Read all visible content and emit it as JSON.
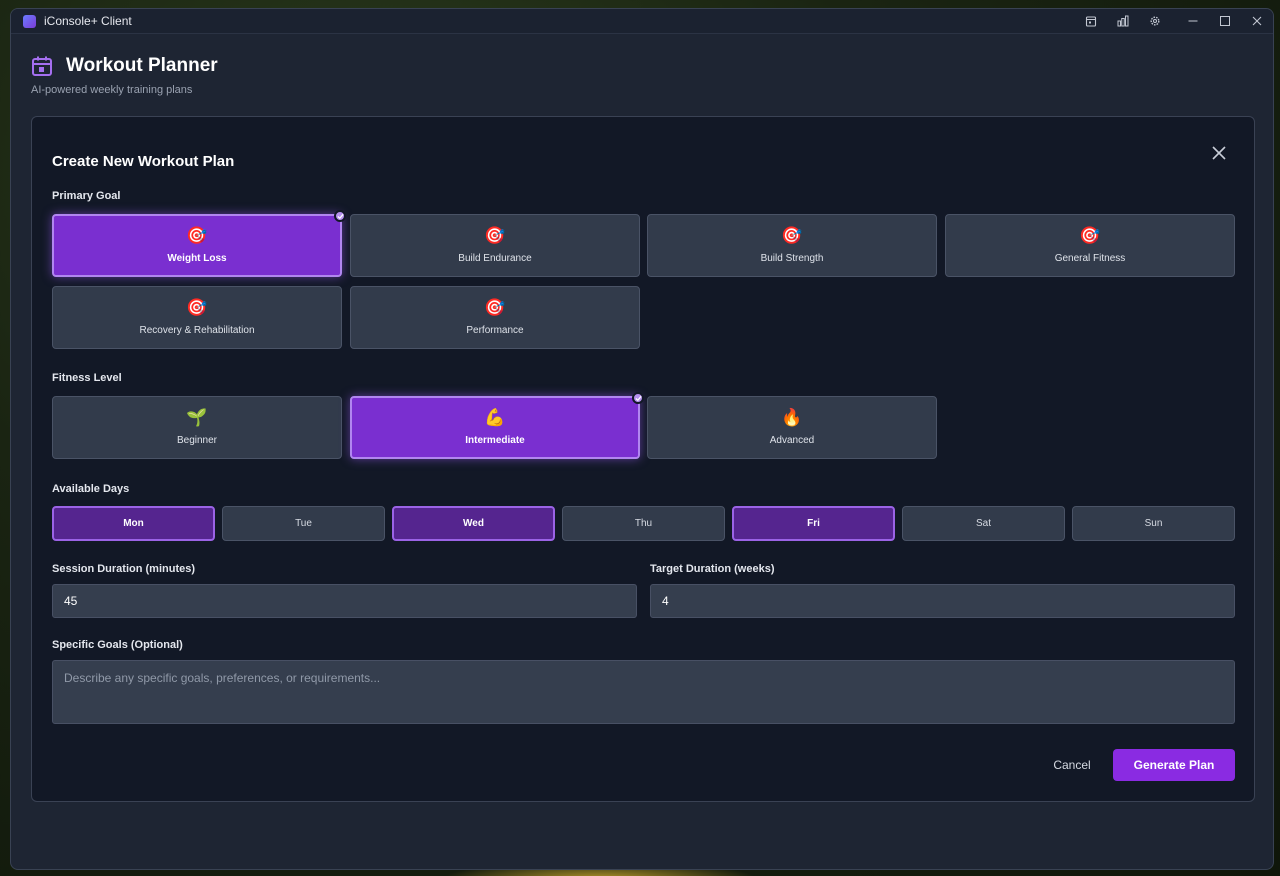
{
  "window": {
    "title": "iConsole+ Client"
  },
  "header": {
    "title": "Workout Planner",
    "subtitle": "AI-powered weekly training plans"
  },
  "modal": {
    "title": "Create New Workout Plan",
    "primary_goal": {
      "label": "Primary Goal",
      "options": [
        {
          "label": "Weight Loss",
          "icon": "🎯",
          "selected": true
        },
        {
          "label": "Build Endurance",
          "icon": "🎯",
          "selected": false
        },
        {
          "label": "Build Strength",
          "icon": "🎯",
          "selected": false
        },
        {
          "label": "General Fitness",
          "icon": "🎯",
          "selected": false
        },
        {
          "label": "Recovery & Rehabilitation",
          "icon": "🎯",
          "selected": false
        },
        {
          "label": "Performance",
          "icon": "🎯",
          "selected": false
        }
      ]
    },
    "fitness_level": {
      "label": "Fitness Level",
      "options": [
        {
          "label": "Beginner",
          "icon": "🌱",
          "selected": false
        },
        {
          "label": "Intermediate",
          "icon": "💪",
          "selected": true
        },
        {
          "label": "Advanced",
          "icon": "🔥",
          "selected": false
        }
      ]
    },
    "available_days": {
      "label": "Available Days",
      "days": [
        {
          "label": "Mon",
          "selected": true
        },
        {
          "label": "Tue",
          "selected": false
        },
        {
          "label": "Wed",
          "selected": true
        },
        {
          "label": "Thu",
          "selected": false
        },
        {
          "label": "Fri",
          "selected": true
        },
        {
          "label": "Sat",
          "selected": false
        },
        {
          "label": "Sun",
          "selected": false
        }
      ]
    },
    "session_duration": {
      "label": "Session Duration (minutes)",
      "value": "45"
    },
    "target_duration": {
      "label": "Target Duration (weeks)",
      "value": "4"
    },
    "specific_goals": {
      "label": "Specific Goals (Optional)",
      "placeholder": "Describe any specific goals, preferences, or requirements..."
    },
    "actions": {
      "cancel": "Cancel",
      "generate": "Generate Plan"
    }
  },
  "colors": {
    "accent": "#8a2be2",
    "selected_card": "#7a2fd0",
    "selected_day": "#55258f",
    "panel": "#121826",
    "window": "#1e2533"
  }
}
